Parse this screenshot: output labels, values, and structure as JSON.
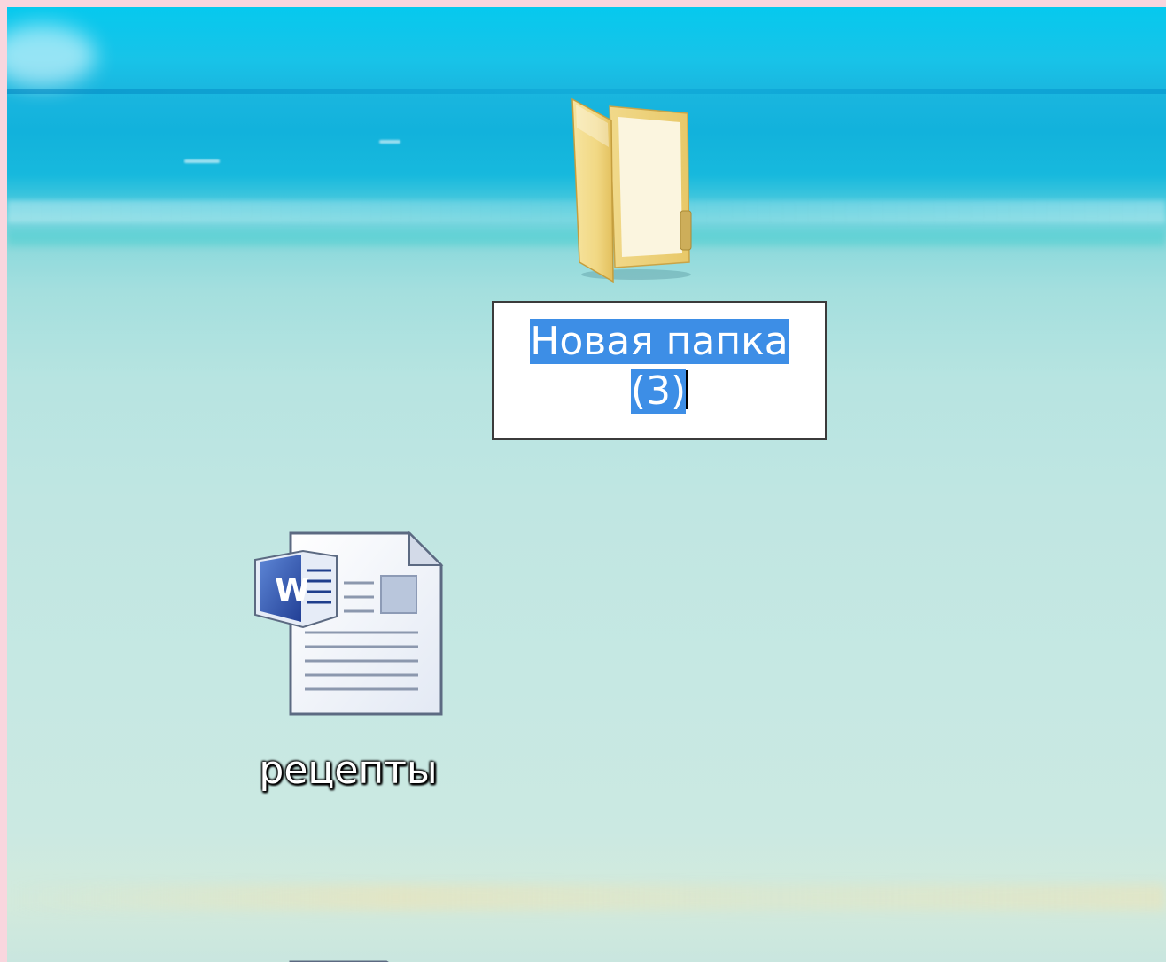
{
  "desktop": {
    "icons": [
      {
        "type": "folder",
        "icon": "folder-icon",
        "rename": {
          "line1": "Новая папка",
          "line2": "(3)"
        }
      },
      {
        "type": "word-document",
        "icon": "word-document-icon",
        "label": "рецепты"
      },
      {
        "type": "word-document",
        "icon": "word-document-icon",
        "label": ""
      }
    ]
  },
  "colors": {
    "selection": "#3d8ee6",
    "frame": "#f9d6de",
    "sea": "#18c3e8"
  }
}
